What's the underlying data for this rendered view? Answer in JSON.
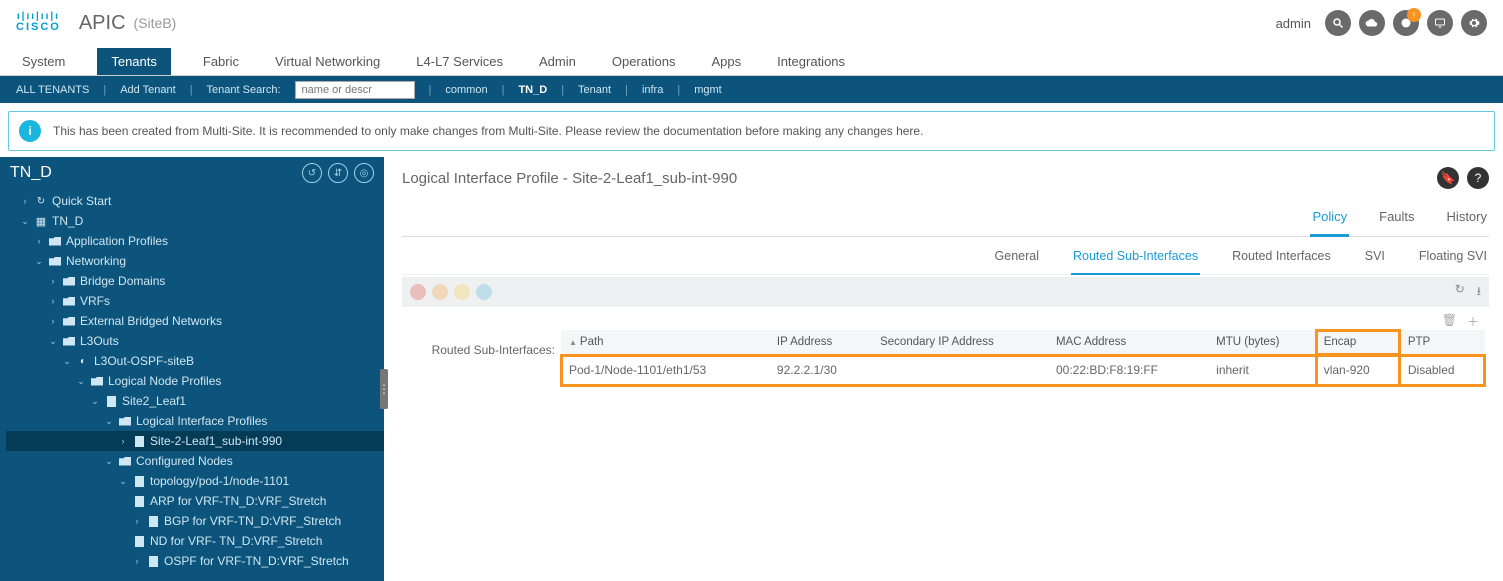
{
  "header": {
    "app": "APIC",
    "site": "(SiteB)",
    "user": "admin"
  },
  "mainTabs": [
    "System",
    "Tenants",
    "Fabric",
    "Virtual Networking",
    "L4-L7 Services",
    "Admin",
    "Operations",
    "Apps",
    "Integrations"
  ],
  "mainTabActive": "Tenants",
  "subbar": {
    "allTenants": "ALL TENANTS",
    "addTenant": "Add Tenant",
    "searchLabel": "Tenant Search:",
    "searchPlaceholder": "name or descr",
    "links": [
      "common",
      "TN_D",
      "Tenant",
      "infra",
      "mgmt"
    ],
    "activeLink": "TN_D"
  },
  "banner": "This has been created from Multi-Site. It is recommended to only make changes from Multi-Site. Please review the documentation before making any changes here.",
  "tree": {
    "root": "TN_D",
    "quickStart": "Quick Start",
    "tenant": "TN_D",
    "appProfiles": "Application Profiles",
    "networking": "Networking",
    "bridgeDomains": "Bridge Domains",
    "vrfs": "VRFs",
    "ebn": "External Bridged Networks",
    "l3outs": "L3Outs",
    "l3out": "L3Out-OSPF-siteB",
    "lnp": "Logical Node Profiles",
    "leaf": "Site2_Leaf1",
    "lip": "Logical Interface Profiles",
    "subint": "Site-2-Leaf1_sub-int-990",
    "confNodes": "Configured Nodes",
    "topo": "topology/pod-1/node-1101",
    "arp": "ARP for VRF-TN_D:VRF_Stretch",
    "bgp": "BGP for VRF-TN_D:VRF_Stretch",
    "nd": "ND for VRF- TN_D:VRF_Stretch",
    "ospf": "OSPF for VRF-TN_D:VRF_Stretch"
  },
  "main": {
    "title": "Logical Interface Profile - Site-2-Leaf1_sub-int-990",
    "tabsTop": [
      "Policy",
      "Faults",
      "History"
    ],
    "tabsTopActive": "Policy",
    "tabsSub": [
      "General",
      "Routed Sub-Interfaces",
      "Routed Interfaces",
      "SVI",
      "Floating SVI"
    ],
    "tabsSubActive": "Routed Sub-Interfaces",
    "sectionLabel": "Routed Sub-Interfaces:",
    "columns": {
      "path": "Path",
      "ip": "IP Address",
      "sip": "Secondary IP Address",
      "mac": "MAC Address",
      "mtu": "MTU (bytes)",
      "encap": "Encap",
      "ptp": "PTP"
    },
    "rows": [
      {
        "path": "Pod-1/Node-1101/eth1/53",
        "ip": "92.2.2.1/30",
        "sip": "",
        "mac": "00:22:BD:F8:19:FF",
        "mtu": "inherit",
        "encap": "vlan-920",
        "ptp": "Disabled"
      }
    ]
  }
}
